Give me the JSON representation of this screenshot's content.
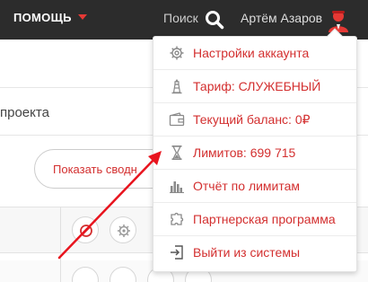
{
  "colors": {
    "accent": "#d32f2f",
    "topbar_bg": "#2c2c2c",
    "arrow": "#e8141e"
  },
  "header": {
    "help_label": "ПОМОЩЬ",
    "search_label": "Поиск",
    "user_name": "Артём Азаров"
  },
  "background": {
    "project_fragment": "проекта",
    "show_button_label": "Показать сводн"
  },
  "menu": {
    "items": [
      {
        "label": "Настройки аккаунта",
        "icon": "gear-icon"
      },
      {
        "label": "Тариф: СЛУЖЕБНЫЙ",
        "icon": "lighthouse-icon"
      },
      {
        "label": "Текущий баланс: 0₽",
        "icon": "wallet-icon"
      },
      {
        "label": "Лимитов: 699 715",
        "icon": "hourglass-icon"
      },
      {
        "label": "Отчёт по лимитам",
        "icon": "bar-chart-icon"
      },
      {
        "label": "Партнерская программа",
        "icon": "puzzle-icon"
      },
      {
        "label": "Выйти из системы",
        "icon": "logout-icon"
      }
    ]
  }
}
